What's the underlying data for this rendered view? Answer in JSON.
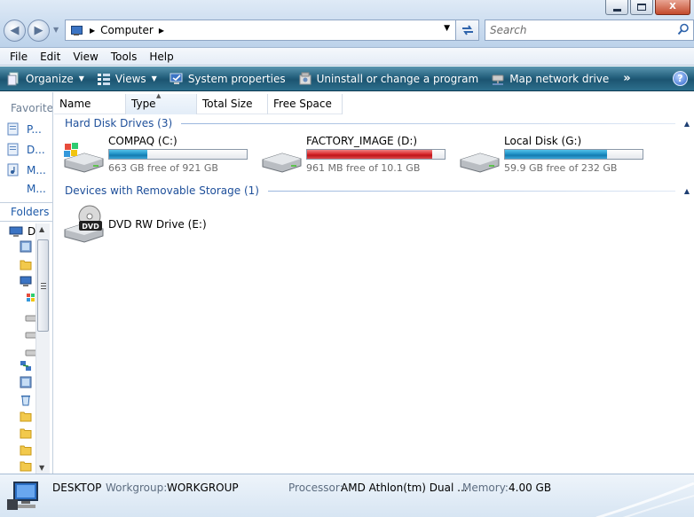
{
  "window": {
    "minimize_glyph": "minimize",
    "maximize_glyph": "maximize",
    "close_glyph": "X"
  },
  "address": {
    "crumb": "Computer"
  },
  "search": {
    "placeholder": "Search"
  },
  "menu": {
    "file": "File",
    "edit": "Edit",
    "view": "View",
    "tools": "Tools",
    "help": "Help"
  },
  "commands": {
    "organize": "Organize",
    "views": "Views",
    "system_properties": "System properties",
    "uninstall": "Uninstall or change a program",
    "map_drive": "Map network drive",
    "more": "»",
    "help": "?"
  },
  "nav": {
    "favorites_head": "Favorite l",
    "fav_links": [
      "P...",
      "D...",
      "M...",
      "M..."
    ],
    "folders_head": "Folders",
    "tree_top": "D"
  },
  "columns": {
    "name": "Name",
    "type": "Type",
    "total_size": "Total Size",
    "free_space": "Free Space"
  },
  "groups": {
    "hdd": "Hard Disk Drives (3)",
    "removable": "Devices with Removable Storage (1)"
  },
  "drives": [
    {
      "name": "COMPAQ (C:)",
      "free": "663 GB free of 921 GB",
      "used_fraction": 0.28,
      "status": "normal"
    },
    {
      "name": "FACTORY_IMAGE (D:)",
      "free": "961 MB free of 10.1 GB",
      "used_fraction": 0.91,
      "status": "low"
    },
    {
      "name": "Local Disk (G:)",
      "free": "59.9 GB free of 232 GB",
      "used_fraction": 0.74,
      "status": "normal"
    }
  ],
  "removable": [
    {
      "name": "DVD RW Drive (E:)",
      "badge": "DVD"
    }
  ],
  "details": {
    "computer_name": "DESKTOP",
    "workgroup_label": "Workgroup:",
    "workgroup": "WORKGROUP",
    "processor_label": "Processor:",
    "processor": "AMD Athlon(tm) Dual ...",
    "memory_label": "Memory:",
    "memory": "4.00 GB"
  },
  "colors": {
    "accent": "#1e4f9a",
    "bar_normal": "#1d8fc4",
    "bar_low": "#d7262a",
    "cmdbar": "#24607d"
  }
}
